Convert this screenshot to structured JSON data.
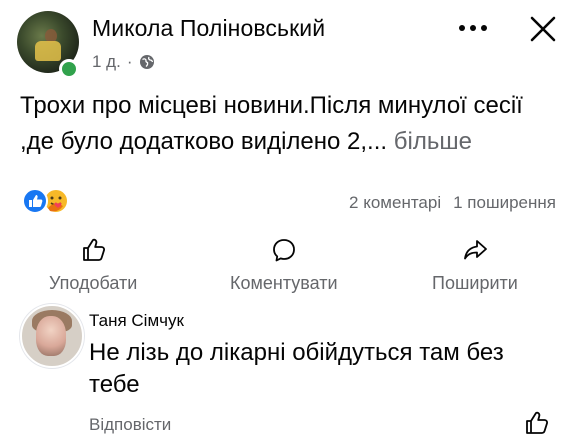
{
  "post": {
    "author": "Микола Поліновський",
    "time": "1 д.",
    "separator": "·",
    "privacy_icon": "globe-icon",
    "text": "Трохи про місцеві новини.Після минулої сесії ,де було додатково виділено 2,...",
    "see_more": "більше",
    "comments_count": "2 коментарі",
    "shares_count": "1 поширення",
    "reactions": [
      "like",
      "care"
    ]
  },
  "actions": {
    "like": "Уподобати",
    "comment": "Коментувати",
    "share": "Поширити"
  },
  "comment": {
    "author": "Таня Сімчук",
    "text": "Не лізь до лікарні обійдуться там без тебе",
    "reply": "Відповісти"
  },
  "colors": {
    "text": "#050505",
    "secondary": "#65676b",
    "like_blue": "#1877f2",
    "online_green": "#31a24c"
  }
}
